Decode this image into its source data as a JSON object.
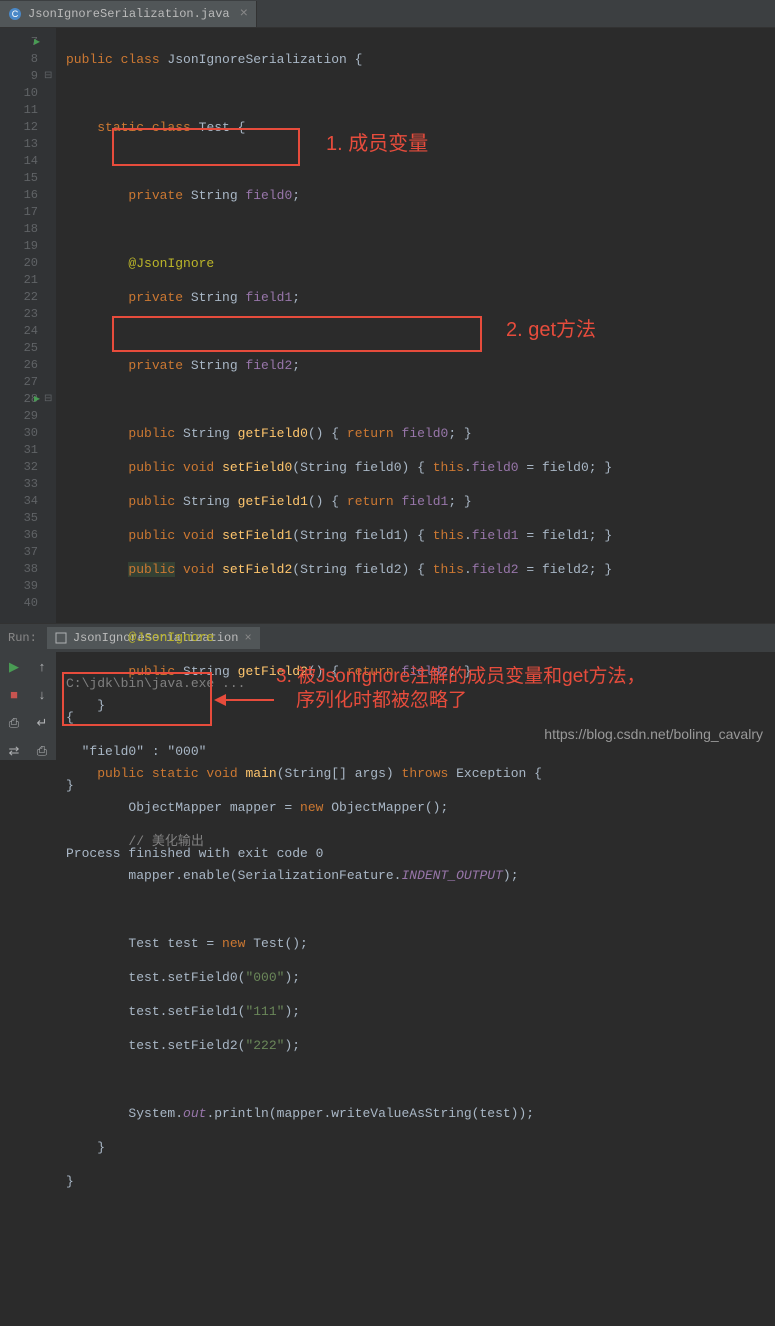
{
  "tab": {
    "filename": "JsonIgnoreSerialization.java",
    "close": "×"
  },
  "lines": [
    7,
    8,
    9,
    10,
    11,
    12,
    13,
    14,
    15,
    16,
    17,
    18,
    19,
    20,
    21,
    22,
    23,
    24,
    25,
    26,
    27,
    28,
    29,
    30,
    31,
    32,
    33,
    34,
    35,
    36,
    37,
    38,
    39,
    40
  ],
  "annotations": {
    "a1": "1. 成员变量",
    "a2": "2. get方法",
    "a3_line1": "3. 被JsonIgnore注解的成员变量和get方法，",
    "a3_line2": "序列化时都被忽略了"
  },
  "run": {
    "label": "Run:",
    "tab_name": "JsonIgnoreSerialization",
    "tab_close": "×",
    "cmd": "C:\\jdk\\bin\\java.exe ...",
    "out1": "{",
    "out2": "  \"field0\" : \"000\"",
    "out3": "}",
    "exit": "Process finished with exit code 0"
  },
  "code": {
    "l7": "public class JsonIgnoreSerialization {",
    "l9": "    static class Test {",
    "l11": "        private String field0;",
    "l13": "        @JsonIgnore",
    "l14": "        private String field1;",
    "l16": "        private String field2;",
    "l18": "        public String getField0() { return field0; }",
    "l19": "        public void setField0(String field0) { this.field0 = field0; }",
    "l20": "        public String getField1() { return field1; }",
    "l21": "        public void setField1(String field1) { this.field1 = field1; }",
    "l22": "        public void setField2(String field2) { this.field2 = field2; }",
    "l24": "        @JsonIgnore",
    "l25": "        public String getField2() { return field2; }",
    "l26": "    }",
    "l28": "    public static void main(String[] args) throws Exception {",
    "l29": "        ObjectMapper mapper = new ObjectMapper();",
    "l30": "        // 美化输出",
    "l31": "        mapper.enable(SerializationFeature.INDENT_OUTPUT);",
    "l33": "        Test test = new Test();",
    "l34": "        test.setField0(\"000\");",
    "l35": "        test.setField1(\"111\");",
    "l36": "        test.setField2(\"222\");",
    "l38": "        System.out.println(mapper.writeValueAsString(test));",
    "l39": "    }",
    "l40": "}"
  },
  "watermark": "https://blog.csdn.net/boling_cavalry"
}
